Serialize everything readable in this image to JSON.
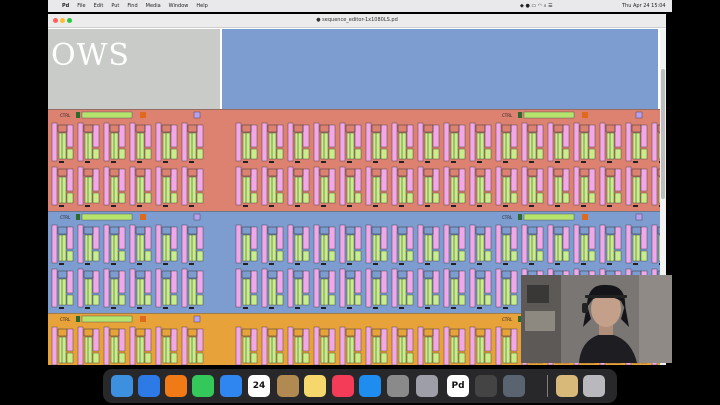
{
  "menubar": {
    "app_name": "Pd",
    "menus": [
      "File",
      "Edit",
      "Put",
      "Find",
      "Media",
      "Window",
      "Help"
    ],
    "clock": "Thu Apr 24 15:04"
  },
  "window": {
    "title": "● sequence_editor-1x1080LS.pd"
  },
  "header": {
    "big_text": "OWS"
  },
  "rows": [
    {
      "color": "#dd8270",
      "control_label": "CTRL"
    },
    {
      "color": "#7d9ccf",
      "control_label": "CTRL"
    },
    {
      "color": "#e8a23a",
      "control_label": "CTRL"
    }
  ],
  "dock": {
    "items": [
      {
        "name": "finder",
        "color": "#3d8fe0",
        "label": ""
      },
      {
        "name": "safari",
        "color": "#2d7ae6",
        "label": ""
      },
      {
        "name": "books",
        "color": "#f07a16",
        "label": ""
      },
      {
        "name": "messages",
        "color": "#34c759",
        "label": ""
      },
      {
        "name": "mail",
        "color": "#2f86f0",
        "label": ""
      },
      {
        "name": "calendar",
        "color": "#ffffff",
        "label": "24"
      },
      {
        "name": "notes-alt",
        "color": "#b08a50",
        "label": ""
      },
      {
        "name": "notes",
        "color": "#f5d76b",
        "label": ""
      },
      {
        "name": "music",
        "color": "#f43b58",
        "label": ""
      },
      {
        "name": "app-store",
        "color": "#1f8cf0",
        "label": ""
      },
      {
        "name": "system-settings",
        "color": "#8a8a8a",
        "label": ""
      },
      {
        "name": "utility",
        "color": "#9e9ea8",
        "label": ""
      },
      {
        "name": "pure-data",
        "color": "#ffffff",
        "label": "Pd"
      },
      {
        "name": "photo-booth",
        "color": "#444444",
        "label": ""
      },
      {
        "name": "screenshot",
        "color": "#5a6470",
        "label": ""
      },
      {
        "name": "downloads",
        "color": "#d9b97a",
        "label": ""
      },
      {
        "name": "trash",
        "color": "#b9b9bd",
        "label": ""
      }
    ]
  }
}
